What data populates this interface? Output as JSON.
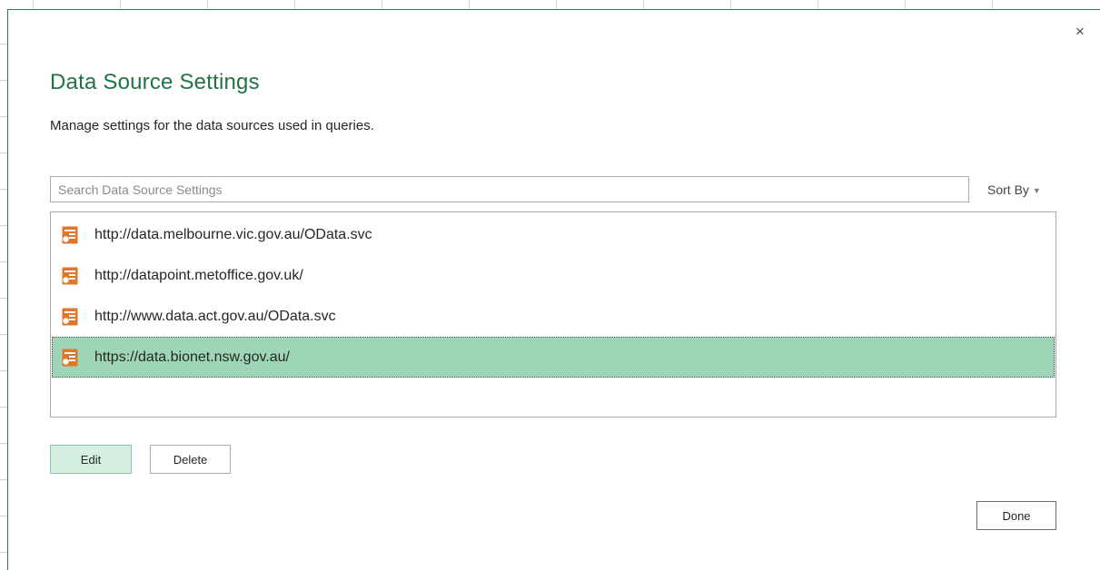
{
  "dialog": {
    "title": "Data Source Settings",
    "subtitle": "Manage settings for the data sources used in queries.",
    "close_label": "×"
  },
  "search": {
    "placeholder": "Search Data Source Settings",
    "value": ""
  },
  "sort": {
    "label": "Sort By",
    "caret": "▼"
  },
  "sources": {
    "icon": "data-source-icon",
    "icon_color": "#e2762b",
    "selected_color": "#9fd5b7",
    "selected_index": 3,
    "items": [
      {
        "label": "http://data.melbourne.vic.gov.au/OData.svc"
      },
      {
        "label": "http://datapoint.metoffice.gov.uk/"
      },
      {
        "label": "http://www.data.act.gov.au/OData.svc"
      },
      {
        "label": "https://data.bionet.nsw.gov.au/"
      }
    ]
  },
  "buttons": {
    "edit": "Edit",
    "delete": "Delete",
    "done": "Done"
  },
  "theme": {
    "accent": "#217346"
  }
}
